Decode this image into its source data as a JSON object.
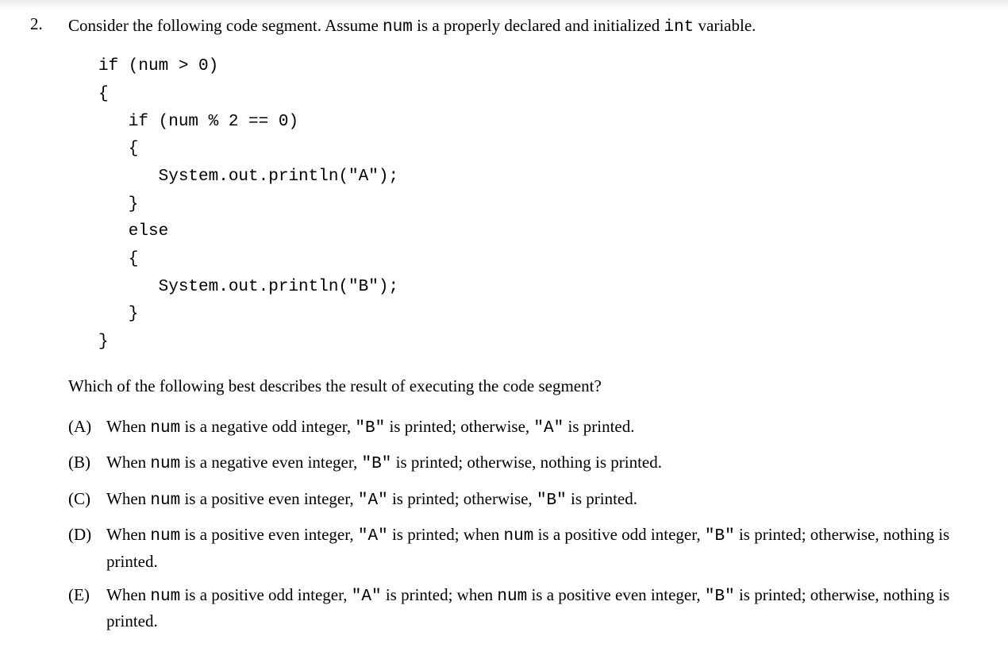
{
  "question": {
    "number": "2.",
    "prompt_parts": [
      "Consider the following code segment. Assume ",
      "num",
      " is a properly declared and initialized ",
      "int",
      " variable."
    ],
    "code": "if (num > 0)\n{\n   if (num % 2 == 0)\n   {\n      System.out.println(\"A\");\n   }\n   else\n   {\n      System.out.println(\"B\");\n   }\n}",
    "subprompt": "Which of the following best describes the result of executing the code segment?",
    "choices": [
      {
        "letter": "(A)",
        "segments": [
          {
            "t": "When ",
            "m": false
          },
          {
            "t": "num",
            "m": true
          },
          {
            "t": " is a negative odd integer, ",
            "m": false
          },
          {
            "t": "\"B\"",
            "m": true
          },
          {
            "t": " is printed; otherwise, ",
            "m": false
          },
          {
            "t": "\"A\"",
            "m": true
          },
          {
            "t": " is printed.",
            "m": false
          }
        ]
      },
      {
        "letter": "(B)",
        "segments": [
          {
            "t": "When ",
            "m": false
          },
          {
            "t": "num",
            "m": true
          },
          {
            "t": " is a negative even integer, ",
            "m": false
          },
          {
            "t": "\"B\"",
            "m": true
          },
          {
            "t": " is printed; otherwise, nothing is printed.",
            "m": false
          }
        ]
      },
      {
        "letter": "(C)",
        "segments": [
          {
            "t": "When ",
            "m": false
          },
          {
            "t": "num",
            "m": true
          },
          {
            "t": " is a positive even integer, ",
            "m": false
          },
          {
            "t": "\"A\"",
            "m": true
          },
          {
            "t": " is printed; otherwise, ",
            "m": false
          },
          {
            "t": "\"B\"",
            "m": true
          },
          {
            "t": " is printed.",
            "m": false
          }
        ]
      },
      {
        "letter": "(D)",
        "segments": [
          {
            "t": "When ",
            "m": false
          },
          {
            "t": "num",
            "m": true
          },
          {
            "t": " is a positive even integer, ",
            "m": false
          },
          {
            "t": "\"A\"",
            "m": true
          },
          {
            "t": " is printed; when ",
            "m": false
          },
          {
            "t": "num",
            "m": true
          },
          {
            "t": " is a positive odd integer, ",
            "m": false
          },
          {
            "t": "\"B\"",
            "m": true
          },
          {
            "t": " is printed; otherwise, nothing is printed.",
            "m": false
          }
        ]
      },
      {
        "letter": "(E)",
        "segments": [
          {
            "t": "When ",
            "m": false
          },
          {
            "t": "num",
            "m": true
          },
          {
            "t": " is a positive odd integer, ",
            "m": false
          },
          {
            "t": "\"A\"",
            "m": true
          },
          {
            "t": " is printed; when ",
            "m": false
          },
          {
            "t": "num",
            "m": true
          },
          {
            "t": " is a positive even integer, ",
            "m": false
          },
          {
            "t": "\"B\"",
            "m": true
          },
          {
            "t": " is printed; otherwise, nothing is printed.",
            "m": false
          }
        ]
      }
    ]
  }
}
